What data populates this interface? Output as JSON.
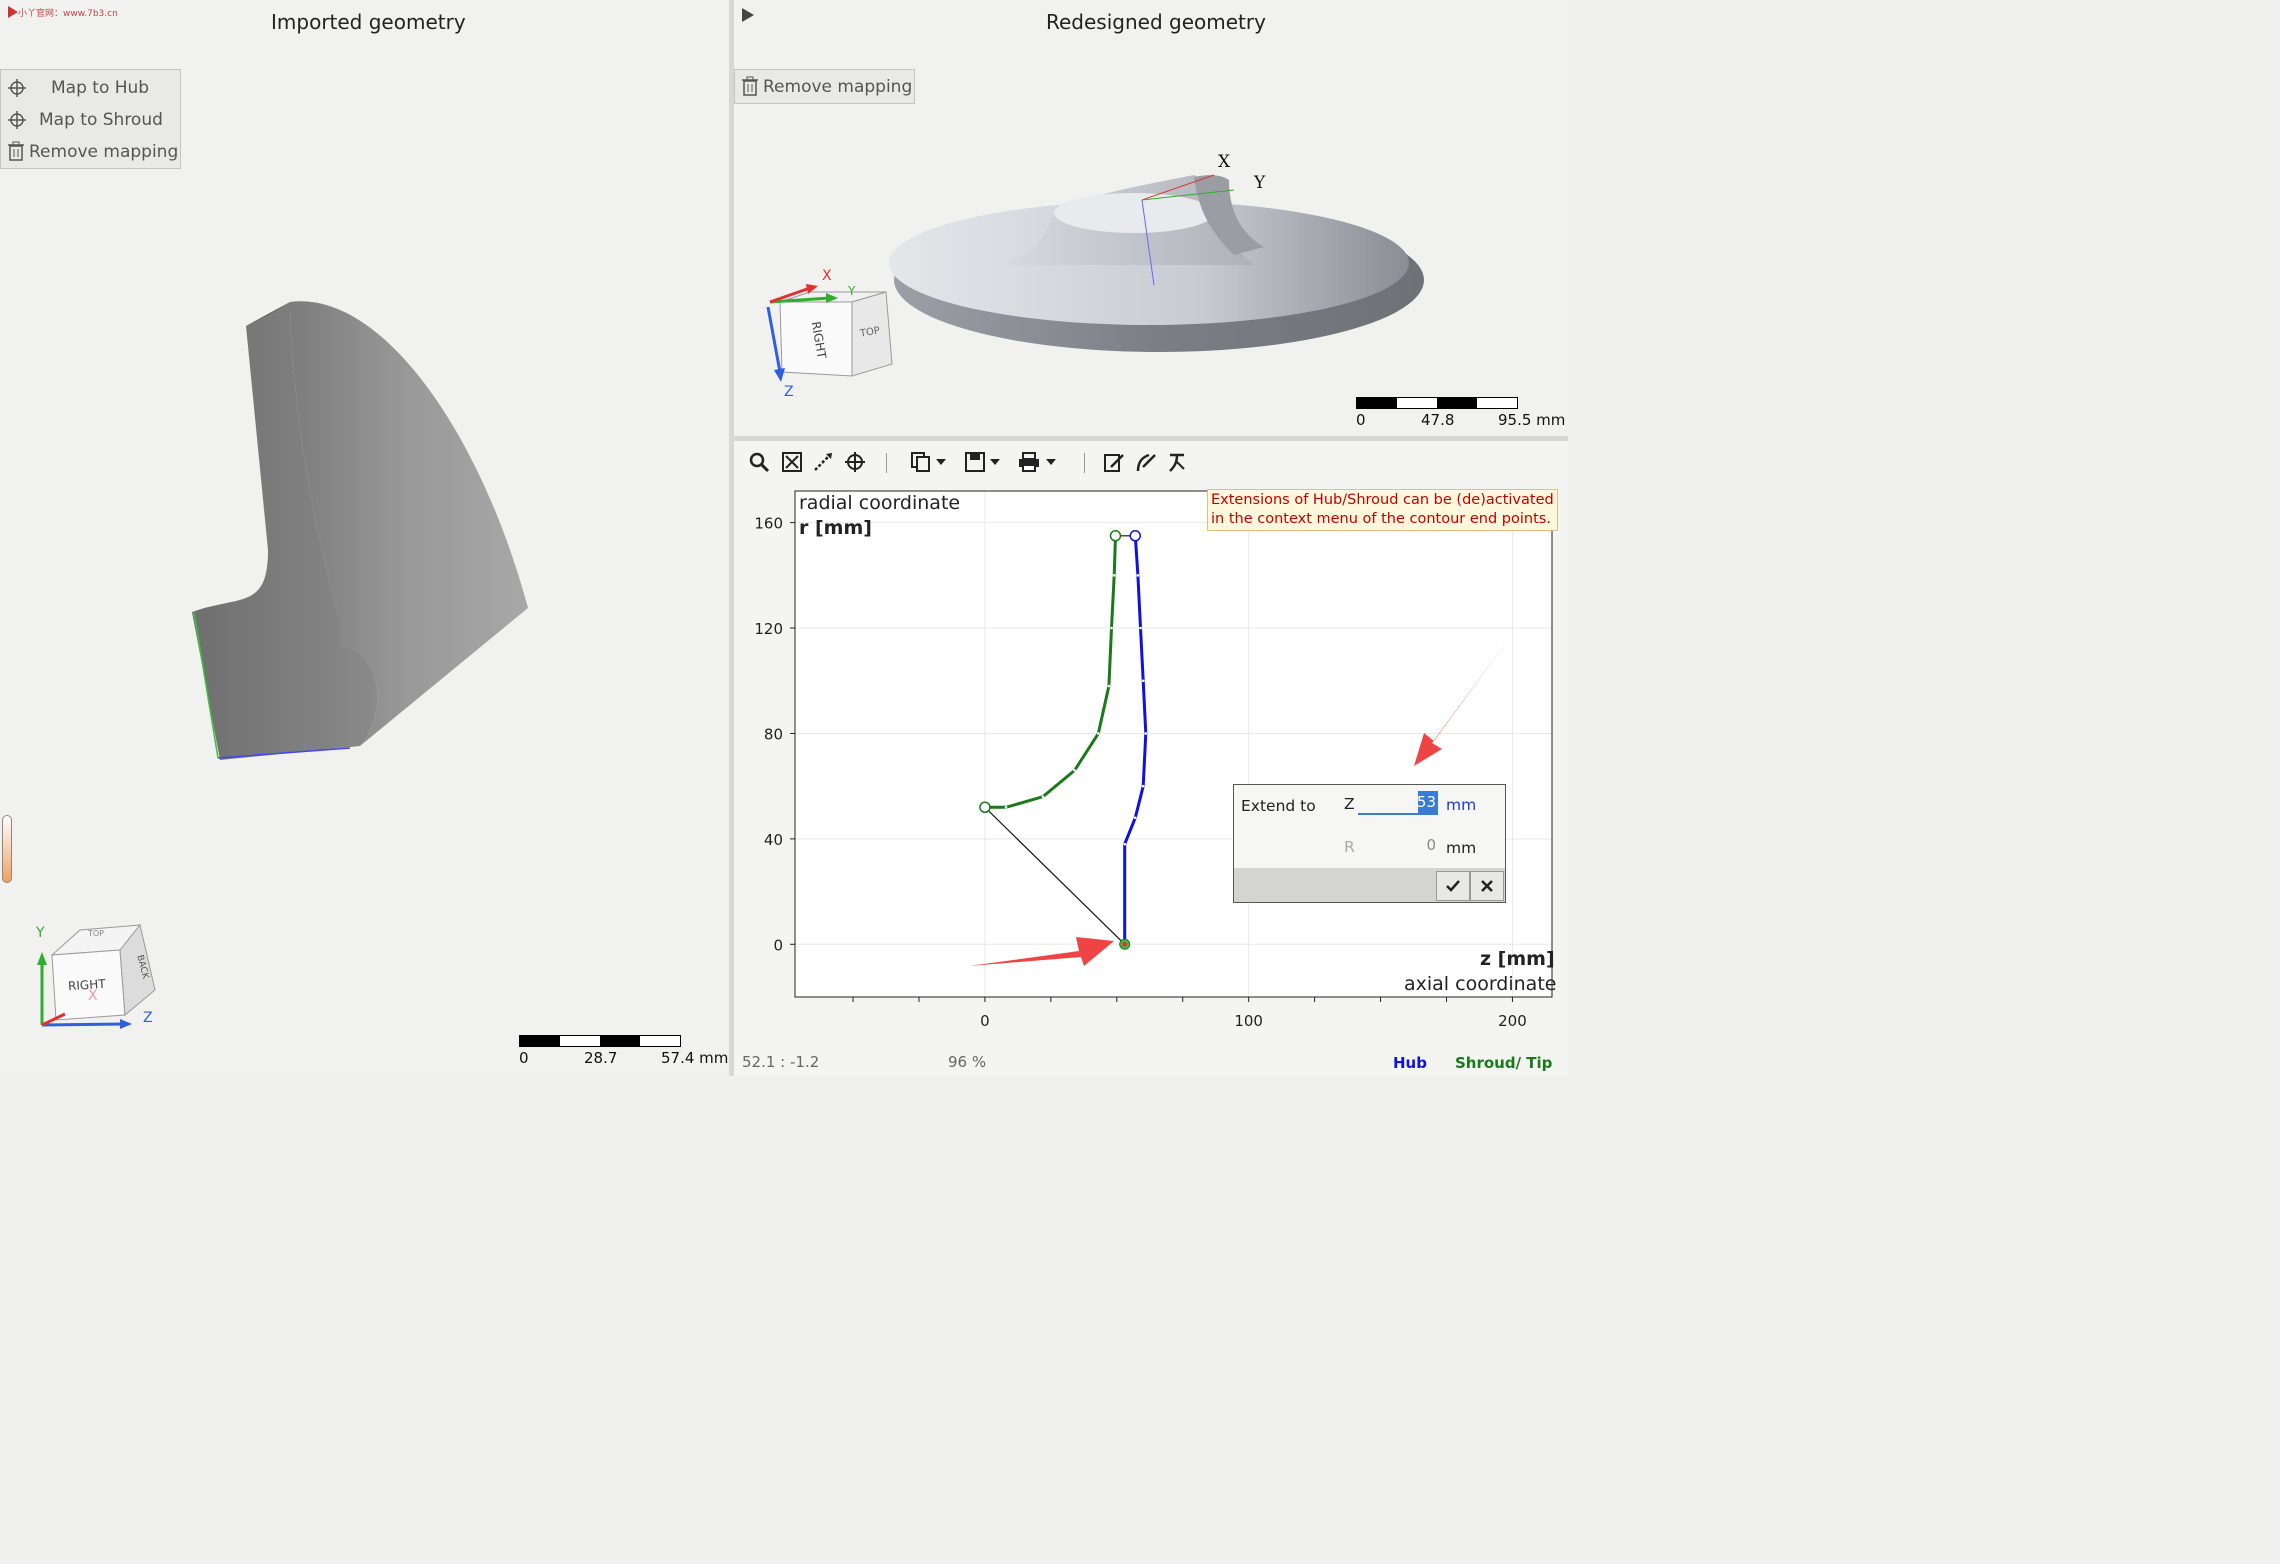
{
  "left_panel": {
    "watermark": "小丫官网：www.7b3.cn",
    "title": "Imported geometry",
    "context_menu": [
      {
        "label": "Map to Hub",
        "icon": "crosshair-icon"
      },
      {
        "label": "Map to Shroud",
        "icon": "crosshair-icon"
      },
      {
        "label": "Remove mapping",
        "icon": "trash-icon"
      }
    ],
    "view_cube": {
      "front": "RIGHT",
      "top": "TOP",
      "side": "BACK",
      "axis_y": "Y",
      "axis_z": "Z",
      "axis_x": "X"
    },
    "scale": {
      "labels": [
        "0",
        "28.7",
        "57.4 mm"
      ]
    }
  },
  "right_top_panel": {
    "title": "Redesigned geometry",
    "remove_mapping_label": "Remove mapping",
    "axes": {
      "x": "X",
      "y": "Y"
    },
    "view_cube": {
      "front": "RIGHT",
      "side": "TOP",
      "axis_x": "X",
      "axis_y": "Y",
      "axis_z": "Z"
    },
    "scale": {
      "labels": [
        "0",
        "47.8",
        "95.5 mm"
      ]
    }
  },
  "chart_panel": {
    "toolbar": [
      {
        "name": "zoom-icon"
      },
      {
        "name": "fit-view-icon"
      },
      {
        "name": "measure-icon"
      },
      {
        "name": "crosshair-icon"
      },
      {
        "name": "copy-icon"
      },
      {
        "name": "copy-dropdown-icon"
      },
      {
        "name": "save-icon"
      },
      {
        "name": "save-dropdown-icon"
      },
      {
        "name": "print-icon"
      },
      {
        "name": "print-dropdown-icon"
      },
      {
        "name": "edit-hub-icon"
      },
      {
        "name": "edit-shroud-icon"
      },
      {
        "name": "edit-tip-icon"
      }
    ],
    "y_axis": {
      "title": "radial coordinate",
      "unit": "r [mm]"
    },
    "x_axis": {
      "title": "axial coordinate",
      "unit": "z [mm]"
    },
    "note_line1": "Extensions of Hub/Shroud can be (de)activated",
    "note_line2": "in the context menu of the contour end points.",
    "extend_dialog": {
      "label": "Extend to",
      "z_label": "Z",
      "z_value": "53",
      "z_unit": "mm",
      "r_label": "R",
      "r_value": "0",
      "r_unit": "mm"
    },
    "status": {
      "coords": "52.1 : -1.2",
      "zoom": "96 %",
      "hub_label": "Hub",
      "shroud_label": "Shroud/ Tip"
    },
    "colors": {
      "hub": "#1a7a1a",
      "shroud": "#1010e0",
      "annotation_arrow": "#ee4444"
    }
  },
  "chart_data": {
    "type": "line",
    "x_ticks": [
      0,
      100,
      200
    ],
    "y_ticks": [
      0,
      40,
      80,
      120,
      160
    ],
    "xlim": [
      -72,
      215
    ],
    "ylim": [
      -20,
      172
    ],
    "series": [
      {
        "name": "Hub",
        "color": "#1a7a1a",
        "points": [
          [
            0,
            52
          ],
          [
            8,
            52
          ],
          [
            22,
            56
          ],
          [
            34,
            66
          ],
          [
            43,
            80
          ],
          [
            47,
            98
          ],
          [
            48,
            120
          ],
          [
            49,
            140
          ],
          [
            49.5,
            155
          ]
        ]
      },
      {
        "name": "Shroud/ Tip",
        "color": "#1010e0",
        "points": [
          [
            53,
            0
          ],
          [
            53,
            38
          ],
          [
            57,
            48
          ],
          [
            60,
            60
          ],
          [
            61,
            80
          ],
          [
            60,
            100
          ],
          [
            59,
            120
          ],
          [
            58,
            140
          ],
          [
            57,
            155
          ]
        ]
      }
    ],
    "connectors": [
      {
        "from": [
          0,
          52
        ],
        "to": [
          53,
          0
        ]
      },
      {
        "from": [
          49.5,
          155
        ],
        "to": [
          57,
          155
        ]
      }
    ],
    "grid": true
  }
}
